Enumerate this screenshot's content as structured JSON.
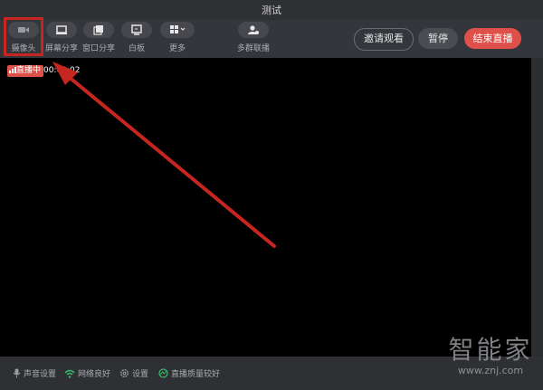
{
  "window": {
    "title": "测试"
  },
  "toolbar": {
    "tools": [
      {
        "label": "摄像头",
        "icon": "camera-icon"
      },
      {
        "label": "屏幕分享",
        "icon": "monitor-icon"
      },
      {
        "label": "窗口分享",
        "icon": "window-icon"
      },
      {
        "label": "白板",
        "icon": "whiteboard-icon"
      },
      {
        "label": "更多",
        "icon": "grid-more-icon"
      },
      {
        "label": "多群联播",
        "icon": "multi-group-icon"
      }
    ],
    "invite_label": "邀请观看",
    "pause_label": "暂停",
    "end_label": "结束直播",
    "accent": "#e0504a"
  },
  "stream": {
    "live_badge": "直播中",
    "elapsed": "00:00:02"
  },
  "statusbar": {
    "audio": "声音设置",
    "network": "网络良好",
    "settings": "设置",
    "quality": "直播质量较好"
  },
  "annotation": {
    "color": "#c7251f"
  },
  "watermark": {
    "brand": "智能家",
    "url": "www.znj.com"
  }
}
